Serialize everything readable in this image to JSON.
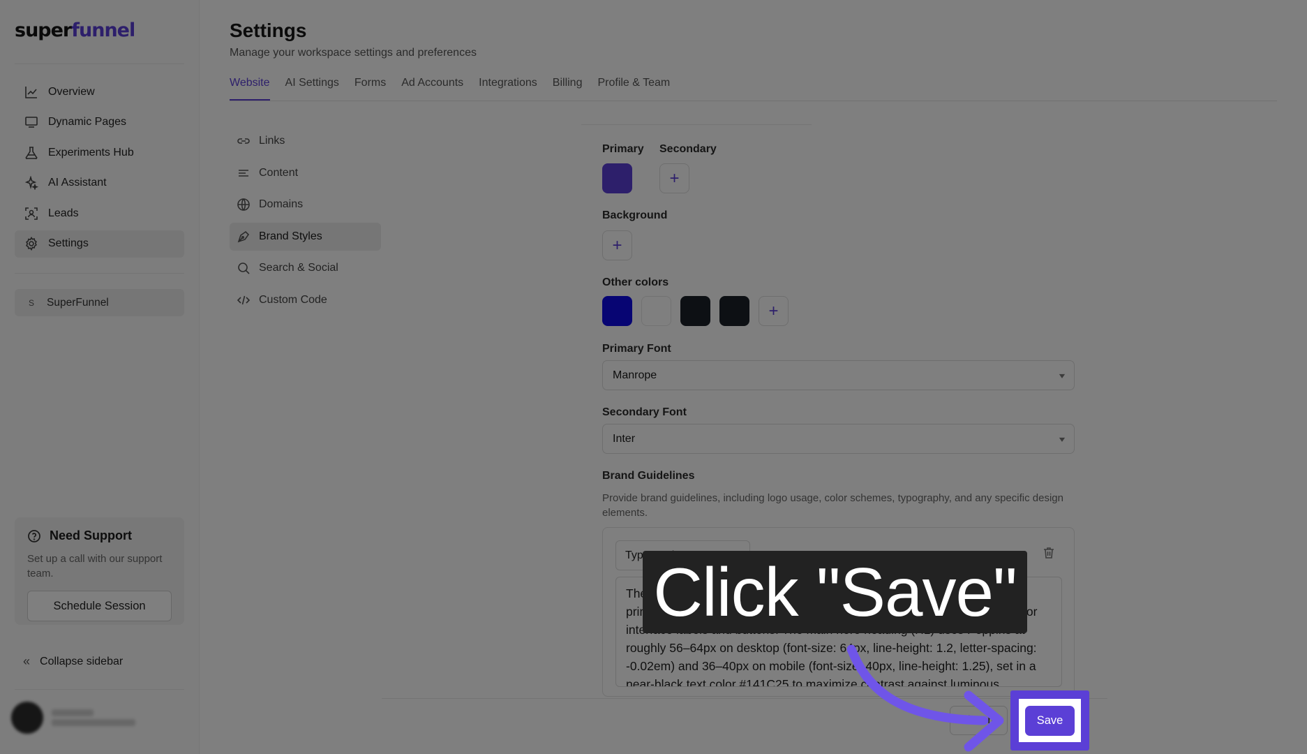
{
  "brand": {
    "logo_main": "super",
    "logo_accent": "funnel",
    "accent_color": "#5b3fd6"
  },
  "sidebar": {
    "items": [
      {
        "label": "Overview",
        "icon": "chart-line-icon"
      },
      {
        "label": "Dynamic Pages",
        "icon": "monitor-icon"
      },
      {
        "label": "Experiments Hub",
        "icon": "flask-icon"
      },
      {
        "label": "AI Assistant",
        "icon": "sparkle-icon"
      },
      {
        "label": "Leads",
        "icon": "user-scan-icon"
      },
      {
        "label": "Settings",
        "icon": "gear-icon"
      }
    ],
    "workspace": {
      "badge": "S",
      "name": "SuperFunnel"
    },
    "support": {
      "title": "Need Support",
      "description": "Set up a call with our support team.",
      "button": "Schedule Session"
    },
    "collapse_label": "Collapse sidebar"
  },
  "header": {
    "title": "Settings",
    "subtitle": "Manage your workspace settings and preferences"
  },
  "tabs": [
    "Website",
    "AI Settings",
    "Forms",
    "Ad Accounts",
    "Integrations",
    "Billing",
    "Profile & Team"
  ],
  "subnav": [
    {
      "label": "Links",
      "icon": "link-icon"
    },
    {
      "label": "Content",
      "icon": "text-lines-icon"
    },
    {
      "label": "Domains",
      "icon": "globe-icon"
    },
    {
      "label": "Brand Styles",
      "icon": "pen-tool-icon"
    },
    {
      "label": "Search & Social",
      "icon": "search-icon"
    },
    {
      "label": "Custom Code",
      "icon": "code-icon"
    }
  ],
  "brand_styles": {
    "primary_label": "Primary",
    "secondary_label": "Secondary",
    "background_label": "Background",
    "other_colors_label": "Other colors",
    "primary_color": "#5b3fd6",
    "other_colors": [
      "#0e0ae6",
      "#ffffff",
      "#1a2028",
      "#1a2028"
    ],
    "primary_font_label": "Primary Font",
    "primary_font_value": "Manrope",
    "secondary_font_label": "Secondary Font",
    "secondary_font_value": "Inter",
    "guidelines_label": "Brand Guidelines",
    "guidelines_desc": "Provide brand guidelines, including logo usage, color schemes, typography, and any specific design elements.",
    "guideline_name": "Typography",
    "guideline_text": "The typography system is clean, contemporary, and highly legible, built primarily around sans-serif faces and modest weights, with light reserved for interface labels and buttons. The main hero heading (H1) uses Poppins at roughly 56–64px on desktop (font-size: 64px, line-height: 1.2, letter-spacing: -0.02em) and 36–40px on mobile (font-size: 40px, line-height: 1.25), set in a near-black text color #141C25 to maximize contrast against luminous"
  },
  "actions": {
    "discard": "Discard",
    "save": "Save"
  },
  "overlay": {
    "callout": "Click \"Save\""
  }
}
